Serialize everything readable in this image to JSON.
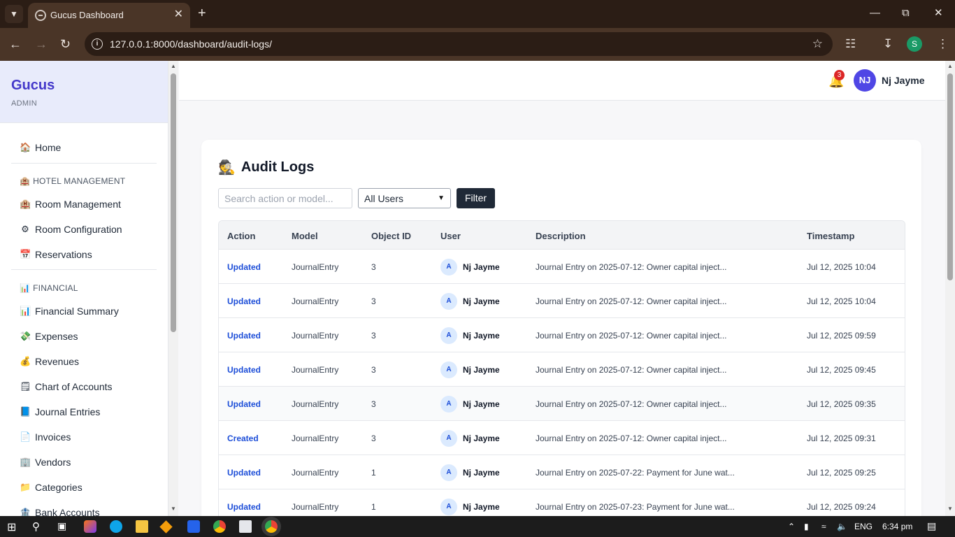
{
  "browser": {
    "tab_title": "Gucus Dashboard",
    "url": "127.0.0.1:8000/dashboard/audit-logs/",
    "profile_initial": "S"
  },
  "sidebar": {
    "brand": "Gucus",
    "role": "ADMIN",
    "home": "Home",
    "sections": [
      {
        "title": "HOTEL MANAGEMENT",
        "items": [
          "Room Management",
          "Room Configuration",
          "Reservations"
        ]
      },
      {
        "title": "FINANCIAL",
        "items": [
          "Financial Summary",
          "Expenses",
          "Revenues",
          "Chart of Accounts",
          "Journal Entries",
          "Invoices",
          "Vendors",
          "Categories",
          "Bank Accounts"
        ]
      }
    ]
  },
  "header": {
    "notification_count": "3",
    "avatar_initials": "NJ",
    "user_name": "Nj Jayme"
  },
  "audit": {
    "title": "Audit Logs",
    "search_placeholder": "Search action or model...",
    "user_filter": "All Users",
    "filter_button": "Filter",
    "columns": [
      "Action",
      "Model",
      "Object ID",
      "User",
      "Description",
      "Timestamp"
    ],
    "rows": [
      {
        "action": "Updated",
        "model": "JournalEntry",
        "object_id": "3",
        "user_initial": "A",
        "user": "Nj Jayme",
        "description": "Journal Entry on 2025-07-12: Owner capital inject...",
        "timestamp": "Jul 12, 2025 10:04"
      },
      {
        "action": "Updated",
        "model": "JournalEntry",
        "object_id": "3",
        "user_initial": "A",
        "user": "Nj Jayme",
        "description": "Journal Entry on 2025-07-12: Owner capital inject...",
        "timestamp": "Jul 12, 2025 10:04"
      },
      {
        "action": "Updated",
        "model": "JournalEntry",
        "object_id": "3",
        "user_initial": "A",
        "user": "Nj Jayme",
        "description": "Journal Entry on 2025-07-12: Owner capital inject...",
        "timestamp": "Jul 12, 2025 09:59"
      },
      {
        "action": "Updated",
        "model": "JournalEntry",
        "object_id": "3",
        "user_initial": "A",
        "user": "Nj Jayme",
        "description": "Journal Entry on 2025-07-12: Owner capital inject...",
        "timestamp": "Jul 12, 2025 09:45"
      },
      {
        "action": "Updated",
        "model": "JournalEntry",
        "object_id": "3",
        "user_initial": "A",
        "user": "Nj Jayme",
        "description": "Journal Entry on 2025-07-12: Owner capital inject...",
        "timestamp": "Jul 12, 2025 09:35"
      },
      {
        "action": "Created",
        "model": "JournalEntry",
        "object_id": "3",
        "user_initial": "A",
        "user": "Nj Jayme",
        "description": "Journal Entry on 2025-07-12: Owner capital inject...",
        "timestamp": "Jul 12, 2025 09:31"
      },
      {
        "action": "Updated",
        "model": "JournalEntry",
        "object_id": "1",
        "user_initial": "A",
        "user": "Nj Jayme",
        "description": "Journal Entry on 2025-07-22: Payment for June wat...",
        "timestamp": "Jul 12, 2025 09:25"
      },
      {
        "action": "Updated",
        "model": "JournalEntry",
        "object_id": "1",
        "user_initial": "A",
        "user": "Nj Jayme",
        "description": "Journal Entry on 2025-07-23: Payment for June wat...",
        "timestamp": "Jul 12, 2025 09:24"
      }
    ]
  },
  "taskbar": {
    "language": "ENG",
    "time": "6:34 pm"
  },
  "colors": {
    "brand": "#4338ca",
    "action_link": "#1d4ed8",
    "filter_button": "#1f2937",
    "avatar": "#4f46e5"
  }
}
